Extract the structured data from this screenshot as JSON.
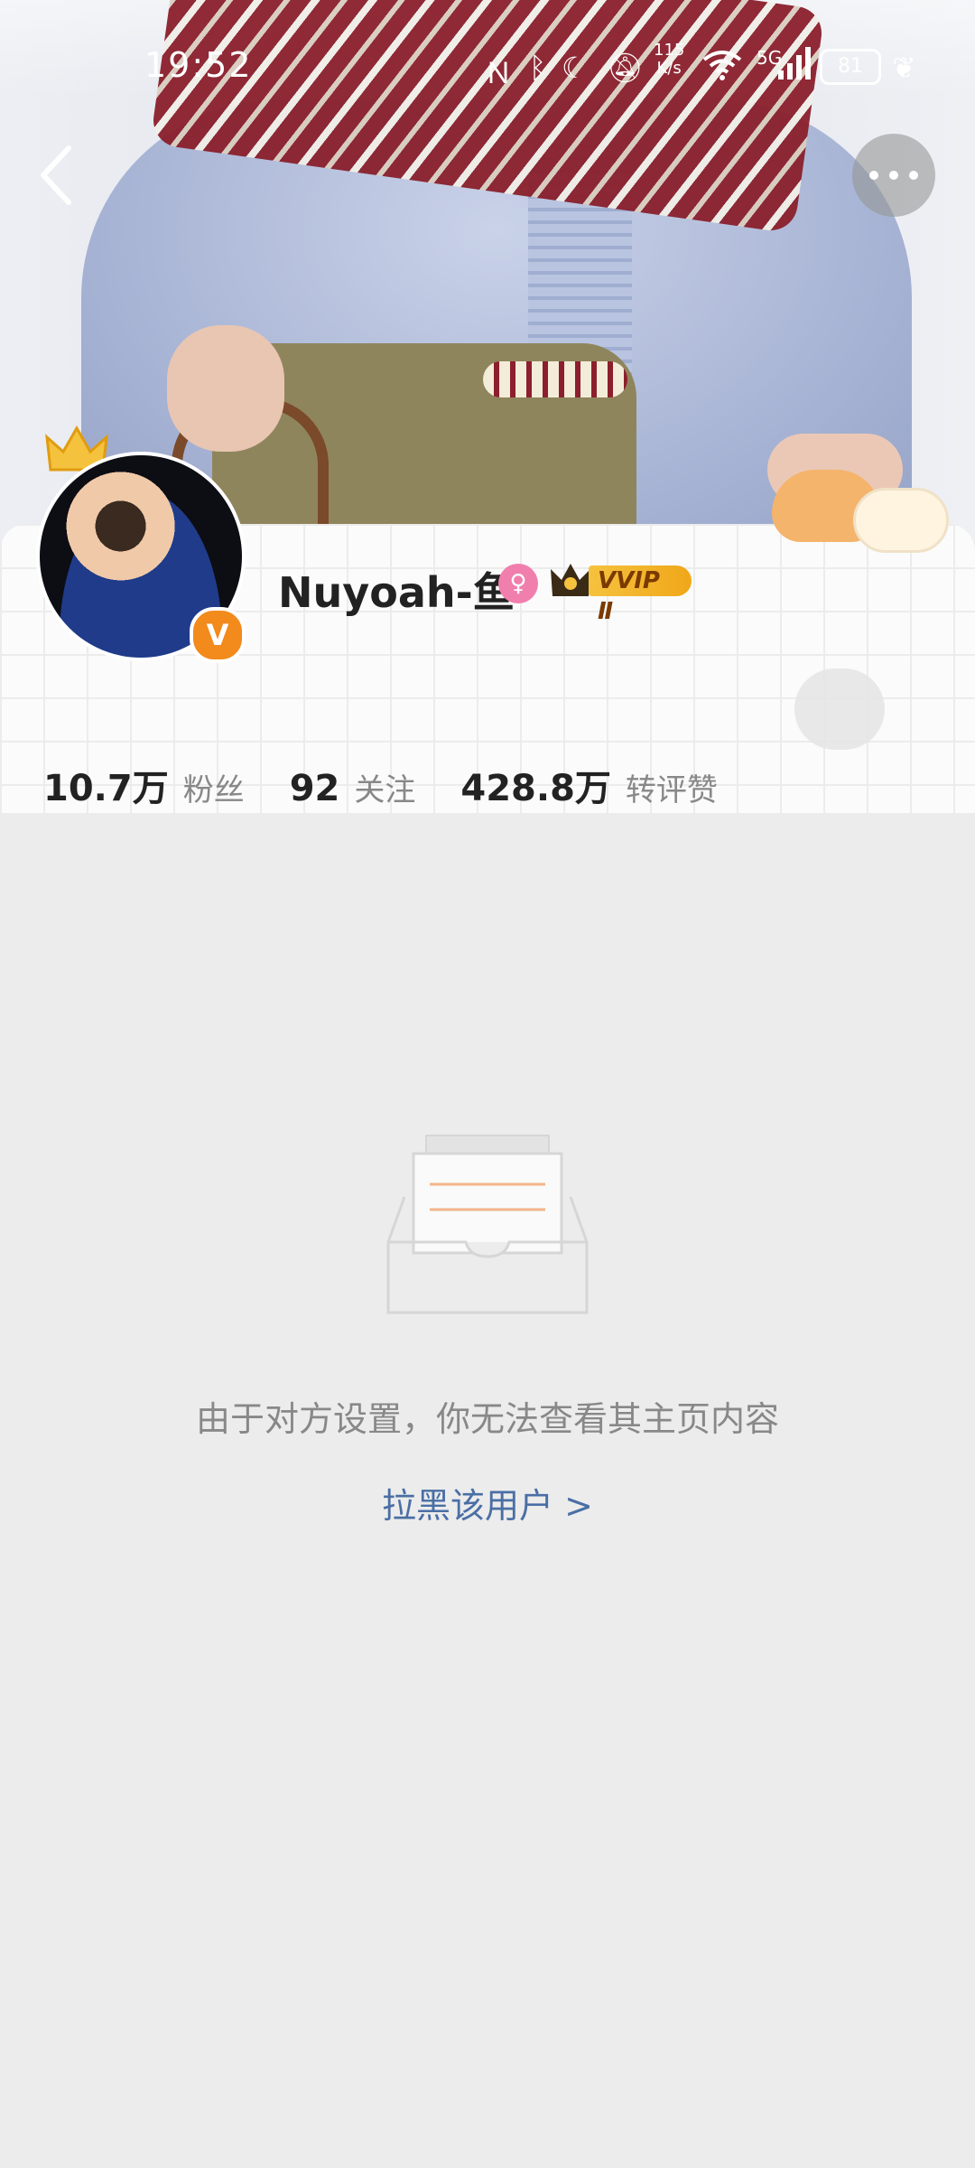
{
  "status_bar": {
    "time": "19:52",
    "network_speed_value": "115",
    "network_speed_unit": "K/s",
    "signal_label": "5G",
    "battery": "81",
    "icons": [
      "nfc-icon",
      "bluetooth-icon",
      "moon-icon",
      "mute-icon",
      "wifi-icon",
      "signal-icon",
      "battery-icon",
      "leaf-icon"
    ]
  },
  "profile": {
    "username": "Nuyoah-鱼",
    "vip_label": "VVIP Ⅱ",
    "verified_badge": "V",
    "gender_icon": "female-icon",
    "colors": {
      "vip_gold": "#f5c23e",
      "verified_orange": "#f28a1c",
      "gender_pink": "#f07fae"
    },
    "stats": [
      {
        "value": "10.7万",
        "label": "粉丝"
      },
      {
        "value": "92",
        "label": "关注"
      },
      {
        "value": "428.8万",
        "label": "转评赞"
      }
    ]
  },
  "empty_state": {
    "message": "由于对方设置，你无法查看其主页内容",
    "action_label": "拉黑该用户",
    "action_chevron": ">",
    "colors": {
      "link": "#4a6fa5",
      "text": "#888888"
    }
  }
}
